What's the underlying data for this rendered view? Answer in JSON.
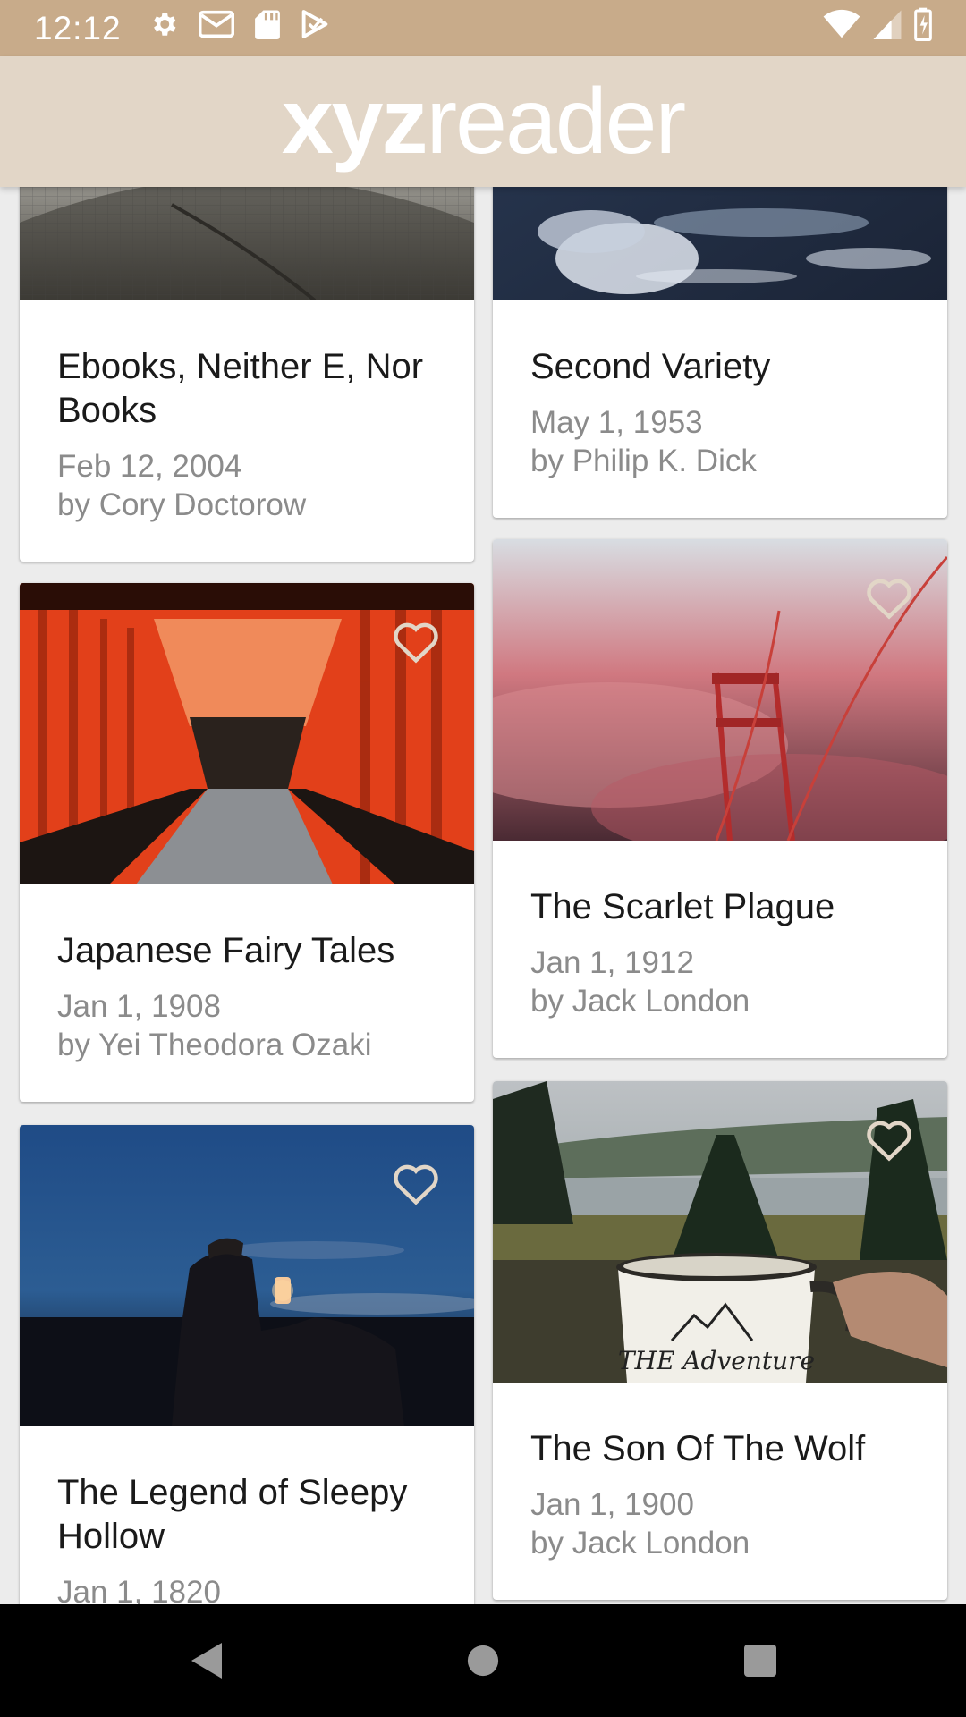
{
  "status_bar": {
    "time": "12:12",
    "left_icons": [
      "gear-icon",
      "gmail-icon",
      "sd-card-icon",
      "play-protect-icon"
    ],
    "right_icons": [
      "wifi-icon",
      "cell-signal-icon",
      "battery-icon"
    ]
  },
  "app_bar": {
    "logo_bold": "xyz",
    "logo_light": "reader",
    "colors": {
      "status_bar": "#c8ab8a",
      "app_bar": "#e2d6c7"
    }
  },
  "articles": [
    {
      "title": "Ebooks, Neither E, Nor Books",
      "date": "Feb 12, 2004",
      "author": "by Cory Doctorow",
      "image": "building-facade-photo",
      "favorite_icon": ""
    },
    {
      "title": "Second Variety",
      "date": "May 1, 1953",
      "author": "by Philip K. Dick",
      "image": "earth-clouds-photo",
      "favorite_icon": ""
    },
    {
      "title": "Japanese Fairy Tales",
      "date": "Jan 1, 1908",
      "author": "by Yei Theodora Ozaki",
      "image": "torii-gates-photo",
      "favorite_icon": "heart-outline-icon"
    },
    {
      "title": "The Scarlet Plague",
      "date": "Jan 1, 1912",
      "author": "by Jack London",
      "image": "bridge-fog-photo",
      "favorite_icon": "heart-outline-icon"
    },
    {
      "title": "The Legend of Sleepy Hollow",
      "date": "Jan 1, 1820",
      "author": "",
      "image": "lantern-rider-photo",
      "favorite_icon": "heart-outline-icon"
    },
    {
      "title": "The Son Of The Wolf",
      "date": "Jan 1, 1900",
      "author": "by Jack London",
      "image": "lake-mug-photo",
      "favorite_icon": "heart-outline-icon",
      "mug_text": "THE Adventure"
    }
  ],
  "nav_bar": {
    "back": "back-icon",
    "home": "home-icon",
    "recents": "recents-icon"
  }
}
